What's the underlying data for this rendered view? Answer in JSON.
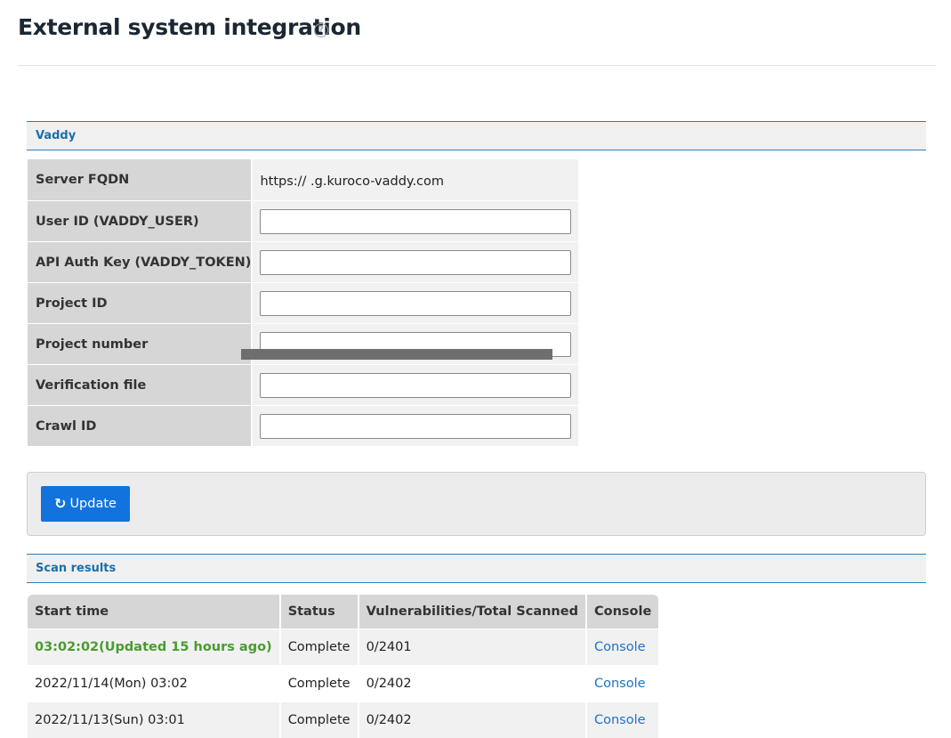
{
  "page": {
    "title": "External system integration",
    "help_icon": "question-circle-icon"
  },
  "vaddy_section": {
    "heading": "Vaddy",
    "fields": [
      {
        "label": "Server FQDN",
        "value": "https://          .g.kuroco-vaddy.com"
      },
      {
        "label": "User ID (VADDY_USER)",
        "value": ""
      },
      {
        "label": "API Auth Key (VADDY_TOKEN)",
        "value": ""
      },
      {
        "label": "Project ID",
        "value": ""
      },
      {
        "label": "Project number",
        "value": ""
      },
      {
        "label": "Verification file",
        "value": ""
      },
      {
        "label": "Crawl ID",
        "value": ""
      }
    ]
  },
  "actions": {
    "update_label": "Update",
    "update_icon": "refresh-icon"
  },
  "scan_section": {
    "heading": "Scan results",
    "columns": [
      "Start time",
      "Status",
      "Vulnerabilities/Total Scanned",
      "Console"
    ],
    "rows": [
      {
        "start": "03:02:02(Updated 15 hours ago)",
        "status": "Complete",
        "vuln": "0/2401",
        "console": "Console"
      },
      {
        "start": "2022/11/14(Mon) 03:02",
        "status": "Complete",
        "vuln": "0/2402",
        "console": "Console"
      },
      {
        "start": "2022/11/13(Sun) 03:01",
        "status": "Complete",
        "vuln": "0/2402",
        "console": "Console"
      }
    ]
  },
  "colors": {
    "accent": "#1273de",
    "section_border": "#2f7cb4",
    "recent_text": "#4a9b2f",
    "link": "#1a73c9"
  }
}
